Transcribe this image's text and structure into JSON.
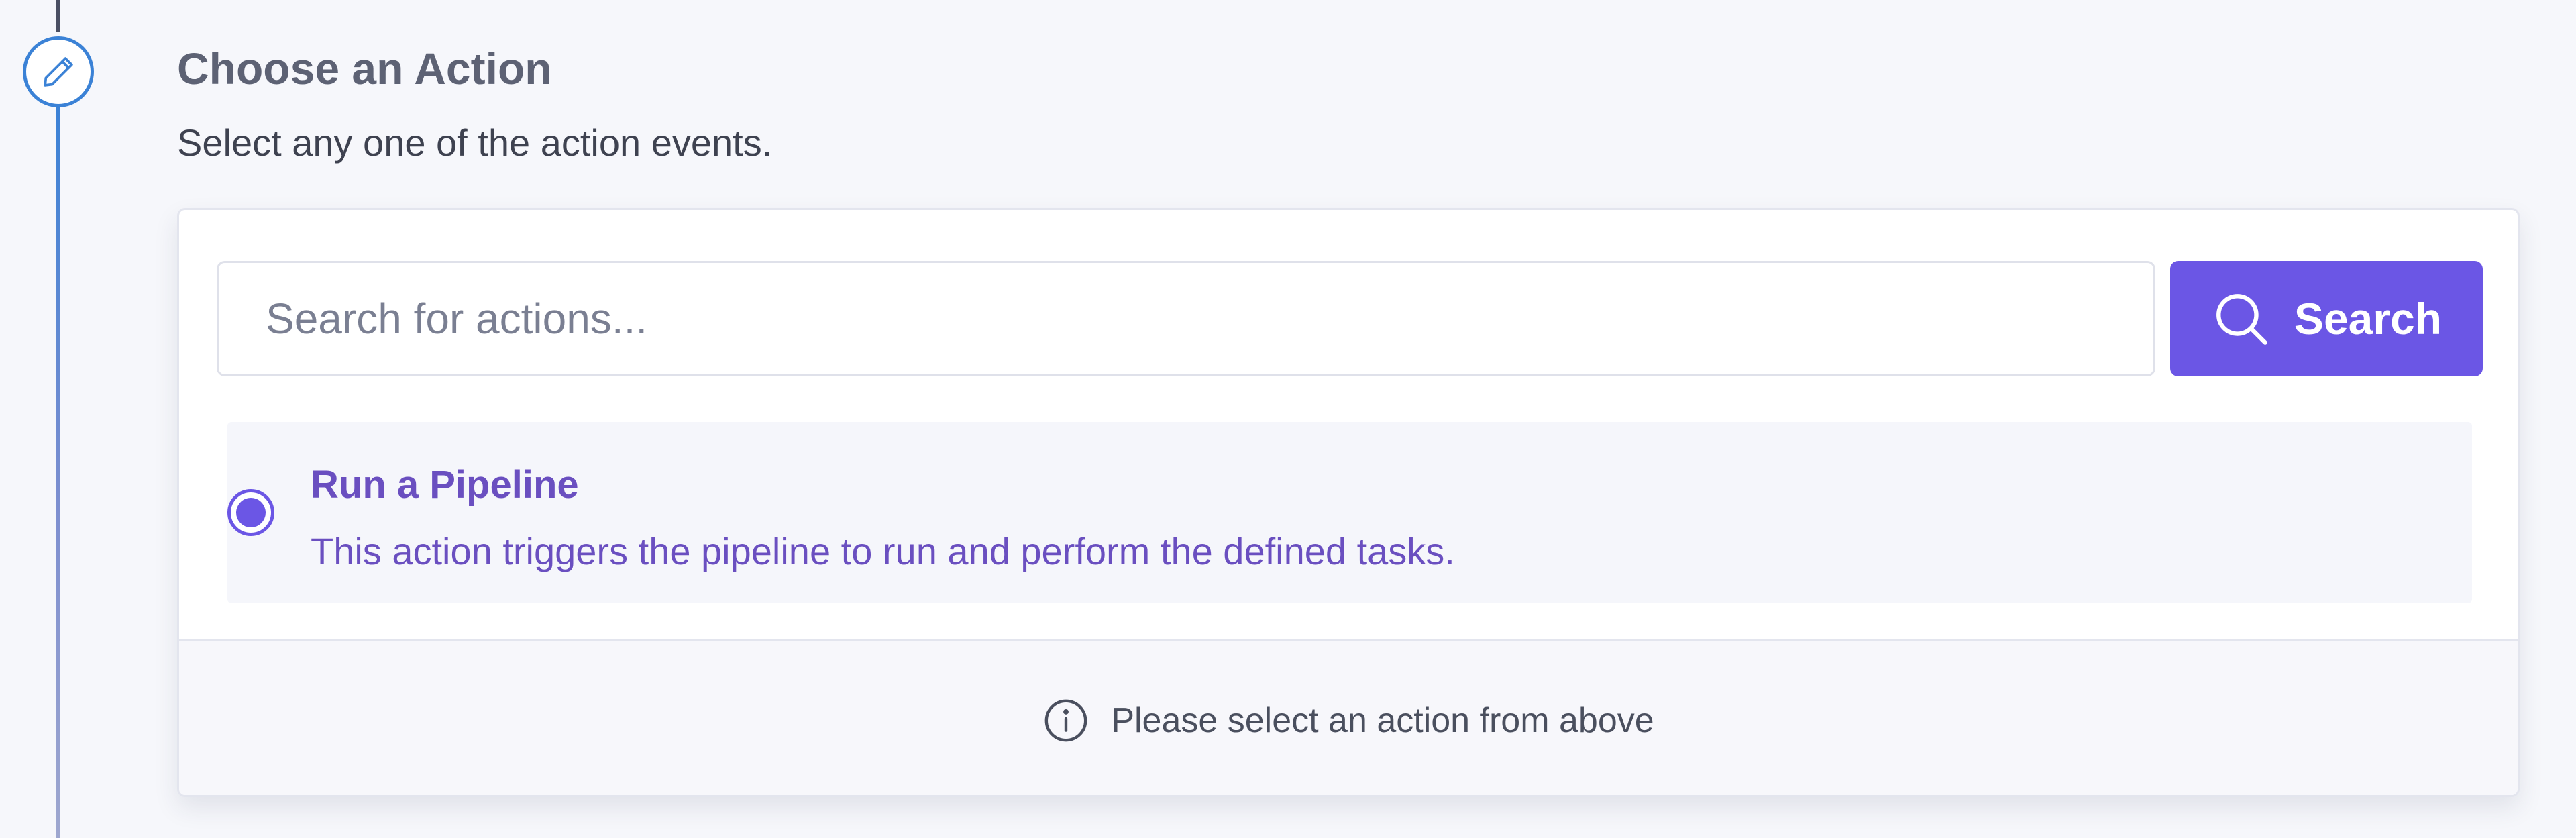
{
  "step": {
    "icon": "pencil-icon",
    "title": "Choose an Action",
    "subtitle": "Select any one of the action events."
  },
  "search": {
    "placeholder": "Search for actions...",
    "value": "",
    "button_label": "Search",
    "button_icon": "search-icon"
  },
  "actions": [
    {
      "title": "Run a Pipeline",
      "description": "This action triggers the pipeline to run and perform the defined tasks.",
      "selected": true
    }
  ],
  "footer": {
    "icon": "info-icon",
    "message": "Please select an action from above"
  },
  "colors": {
    "accent": "#6b56e5",
    "timeline": "#3b82d6",
    "option_text": "#6a4fc0",
    "background": "#f6f7fb"
  }
}
